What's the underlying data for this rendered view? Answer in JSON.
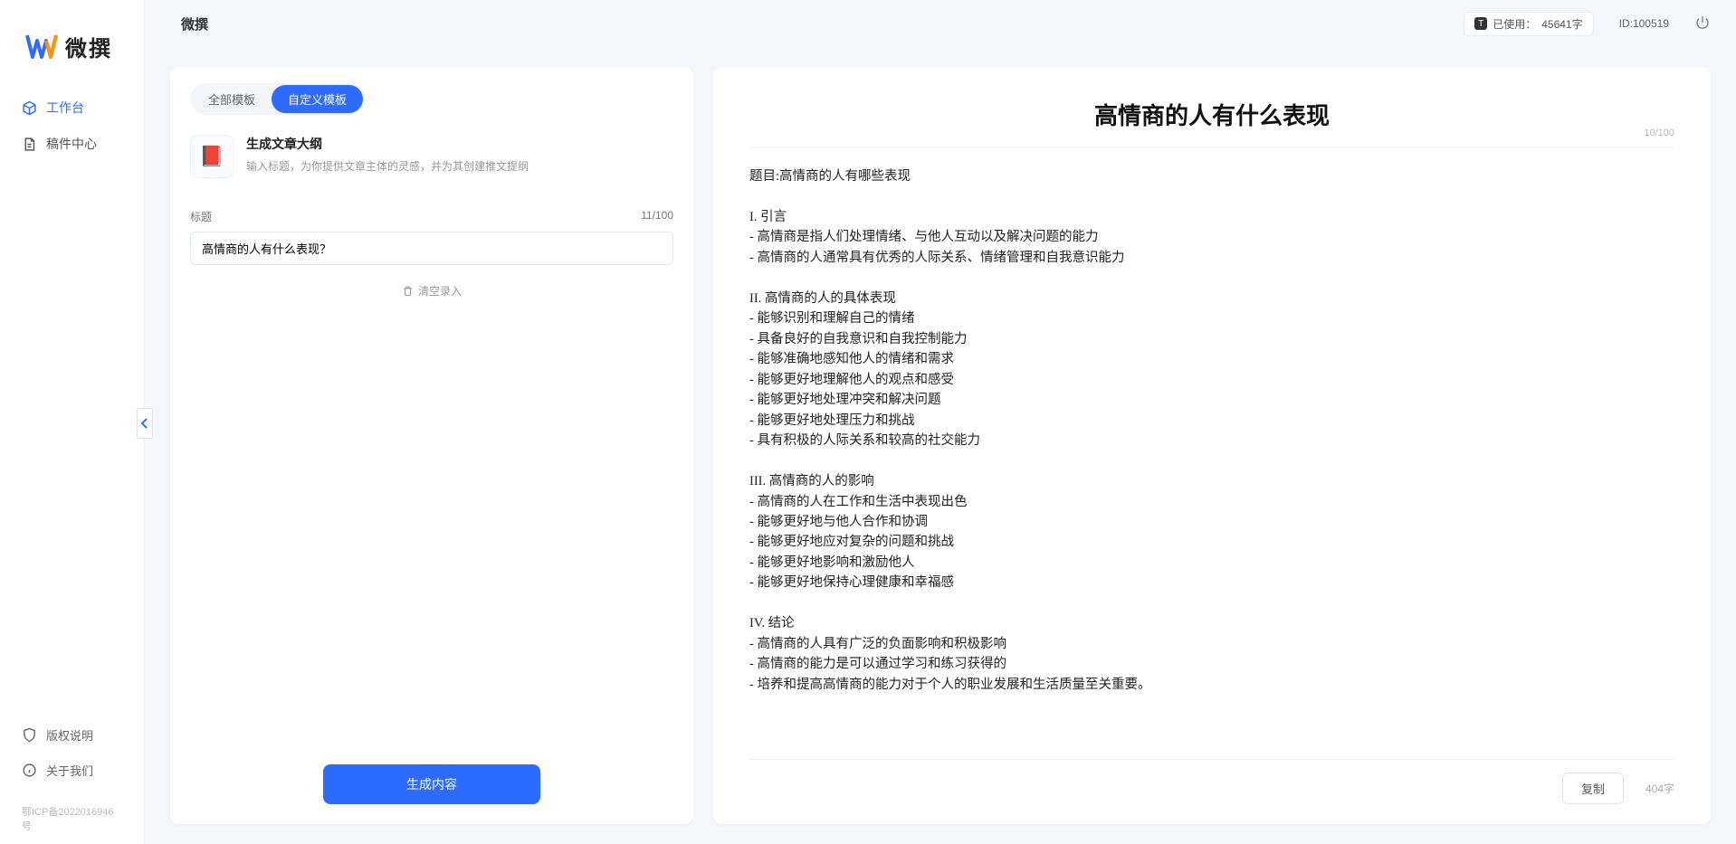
{
  "app": {
    "name": "微撰",
    "page_title": "微撰"
  },
  "header": {
    "usage_label": "已使用：",
    "usage_value": "45641字",
    "usage_badge": "T",
    "user_id_label": "ID:100519"
  },
  "sidebar": {
    "items": [
      {
        "label": "工作台",
        "active": true
      },
      {
        "label": "稿件中心",
        "active": false
      }
    ],
    "bottom": [
      {
        "label": "版权说明"
      },
      {
        "label": "关于我们"
      }
    ],
    "icp": "鄂ICP备2022016946号"
  },
  "left_panel": {
    "tabs": [
      {
        "label": "全部模板",
        "active": false
      },
      {
        "label": "自定义模板",
        "active": true
      }
    ],
    "template": {
      "icon_emoji": "📕",
      "title": "生成文章大纲",
      "desc": "输入标题，为你提供文章主体的灵感，并为其创建推文提纲"
    },
    "title_field": {
      "label": "标题",
      "counter": "11/100",
      "value": "高情商的人有什么表现？"
    },
    "clear_label": "清空录入",
    "generate_label": "生成内容"
  },
  "right_panel": {
    "doc_title": "高情商的人有什么表现",
    "title_counter": "10/100",
    "body": "题目:高情商的人有哪些表现\n\nI. 引言\n- 高情商是指人们处理情绪、与他人互动以及解决问题的能力\n- 高情商的人通常具有优秀的人际关系、情绪管理和自我意识能力\n\nII. 高情商的人的具体表现\n- 能够识别和理解自己的情绪\n- 具备良好的自我意识和自我控制能力\n- 能够准确地感知他人的情绪和需求\n- 能够更好地理解他人的观点和感受\n- 能够更好地处理冲突和解决问题\n- 能够更好地处理压力和挑战\n- 具有积极的人际关系和较高的社交能力\n\nIII. 高情商的人的影响\n- 高情商的人在工作和生活中表现出色\n- 能够更好地与他人合作和协调\n- 能够更好地应对复杂的问题和挑战\n- 能够更好地影响和激励他人\n- 能够更好地保持心理健康和幸福感\n\nIV. 结论\n- 高情商的人具有广泛的负面影响和积极影响\n- 高情商的能力是可以通过学习和练习获得的\n- 培养和提高高情商的能力对于个人的职业发展和生活质量至关重要。",
    "copy_label": "复制",
    "word_count": "404字"
  }
}
